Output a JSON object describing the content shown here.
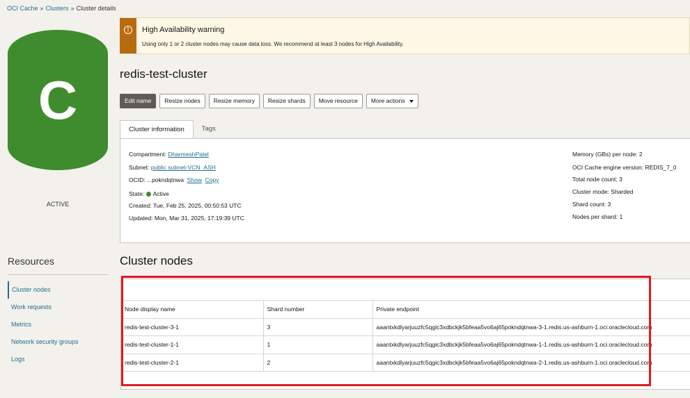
{
  "breadcrumb": {
    "items": [
      "OCI Cache",
      "Clusters",
      "Cluster details"
    ],
    "separator": "»"
  },
  "avatar": {
    "letter": "C",
    "color": "#3e8c2d"
  },
  "state_label": "ACTIVE",
  "resources": {
    "title": "Resources",
    "items": [
      "Cluster nodes",
      "Work requests",
      "Metrics",
      "Network security groups",
      "Logs"
    ]
  },
  "warning": {
    "title": "High Availability warning",
    "text": "Using only 1 or 2 cluster nodes may cause data loss. We recommend at least 3 nodes for High Availability.",
    "icon": "!",
    "accent_color": "#b96a0f"
  },
  "page_title": "redis-test-cluster",
  "actions": {
    "edit_name": "Edit name",
    "resize_nodes": "Resize nodes",
    "resize_memory": "Resize memory",
    "resize_shards": "Resize shards",
    "move_resource": "Move resource",
    "more_actions": "More actions"
  },
  "tabs": [
    "Cluster information",
    "Tags"
  ],
  "info": {
    "compartment_label": "Compartment:",
    "compartment_value": "DharmeshPatel",
    "subnet_label": "Subnet:",
    "subnet_value": "public subnet-VCN_ASH",
    "ocid_label": "OCID:",
    "ocid_value": "...pokndqtnwa",
    "ocid_show": "Show",
    "ocid_copy": "Copy",
    "state_label": "State:",
    "state_value": "Active",
    "created_label": "Created:",
    "created_value": "Tue, Feb 25, 2025, 00:50:53 UTC",
    "updated_label": "Updated:",
    "updated_value": "Mon, Mar 31, 2025, 17:19:39 UTC",
    "memory_label": "Memory (GBs) per node:",
    "memory_value": "2",
    "engine_label": "OCI Cache engine version:",
    "engine_value": "REDIS_7_0",
    "node_count_label": "Total node count:",
    "node_count_value": "3",
    "cluster_mode_label": "Cluster mode:",
    "cluster_mode_value": "Sharded",
    "shard_count_label": "Shard count:",
    "shard_count_value": "3",
    "nodes_per_shard_label": "Nodes per shard:",
    "nodes_per_shard_value": "1"
  },
  "nodes": {
    "title": "Cluster nodes",
    "columns": [
      "Node display name",
      "Shard number",
      "Private endpoint"
    ],
    "rows": [
      [
        "redis-test-cluster-3-1",
        "3",
        "aaantxkdlyarjuuzfc5qgic3xdbckjk5bfeaa5vo6aj65pokndqtnwa-3-1.redis.us-ashburn-1.oci.oraclecloud.com"
      ],
      [
        "redis-test-cluster-1-1",
        "1",
        "aaantxkdlyarjuuzfc5qgic3xdbckjk5bfeaa5vo6aj65pokndqtnwa-1-1.redis.us-ashburn-1.oci.oraclecloud.com"
      ],
      [
        "redis-test-cluster-2-1",
        "2",
        "aaantxkdlyarjuuzfc5qgic3xdbckjk5bfeaa5vo6aj65pokndqtnwa-2-1.redis.us-ashburn-1.oci.oraclecloud.com"
      ]
    ]
  },
  "colors": {
    "link": "#1f6e8f",
    "active_state": "#3e8c2d",
    "highlight": "#e01a24"
  }
}
